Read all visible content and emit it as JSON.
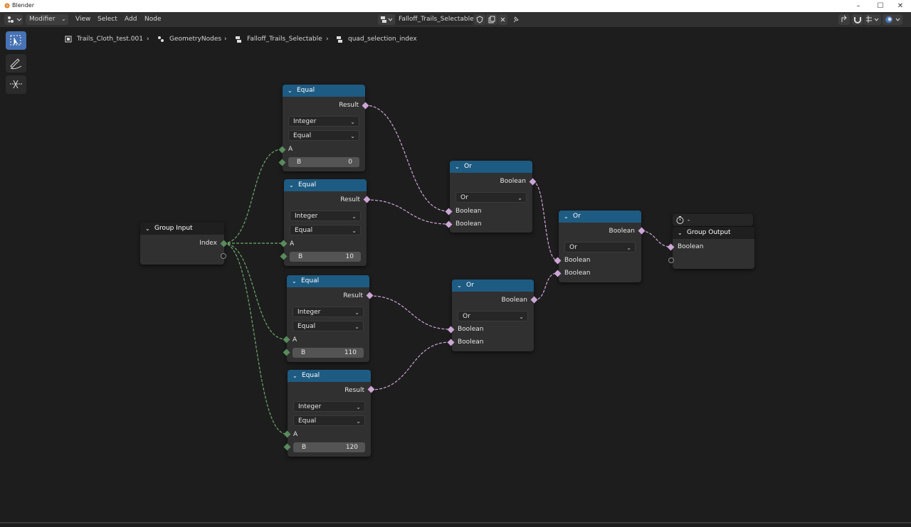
{
  "window": {
    "title": "Blender",
    "controls": [
      "–",
      "☐",
      "✕"
    ]
  },
  "header": {
    "menu": {
      "modifier": "Modifier",
      "view": "View",
      "select": "Select",
      "add": "Add",
      "node": "Node"
    },
    "node_group": {
      "name": "Falloff_Trails_Selectable"
    }
  },
  "breadcrumbs": [
    "Trails_Cloth_test.001",
    "GeometryNodes",
    "Falloff_Trails_Selectable",
    "quad_selection_index"
  ],
  "nodes": {
    "group_input": {
      "title": "Group Input",
      "output": "Index"
    },
    "equal1": {
      "title": "Equal",
      "result": "Result",
      "type": "Integer",
      "op": "Equal",
      "a": "A",
      "b_label": "B",
      "b": "0"
    },
    "equal2": {
      "title": "Equal",
      "result": "Result",
      "type": "Integer",
      "op": "Equal",
      "a": "A",
      "b_label": "B",
      "b": "10"
    },
    "equal3": {
      "title": "Equal",
      "result": "Result",
      "type": "Integer",
      "op": "Equal",
      "a": "A",
      "b_label": "B",
      "b": "110"
    },
    "equal4": {
      "title": "Equal",
      "result": "Result",
      "type": "Integer",
      "op": "Equal",
      "a": "A",
      "b_label": "B",
      "b": "120"
    },
    "or1": {
      "title": "Or",
      "output": "Boolean",
      "op": "Or",
      "in1": "Boolean",
      "in2": "Boolean"
    },
    "or2": {
      "title": "Or",
      "output": "Boolean",
      "op": "Or",
      "in1": "Boolean",
      "in2": "Boolean"
    },
    "or3": {
      "title": "Or",
      "output": "Boolean",
      "op": "Or",
      "in1": "Boolean",
      "in2": "Boolean"
    },
    "group_output": {
      "title": "Group Output",
      "input": "Boolean",
      "frame_label": "-"
    }
  },
  "colors": {
    "node_header": "#1e5b82",
    "boolean_socket": "#cca6d6",
    "integer_socket": "#598c5c",
    "active_tool": "#4772b3"
  }
}
